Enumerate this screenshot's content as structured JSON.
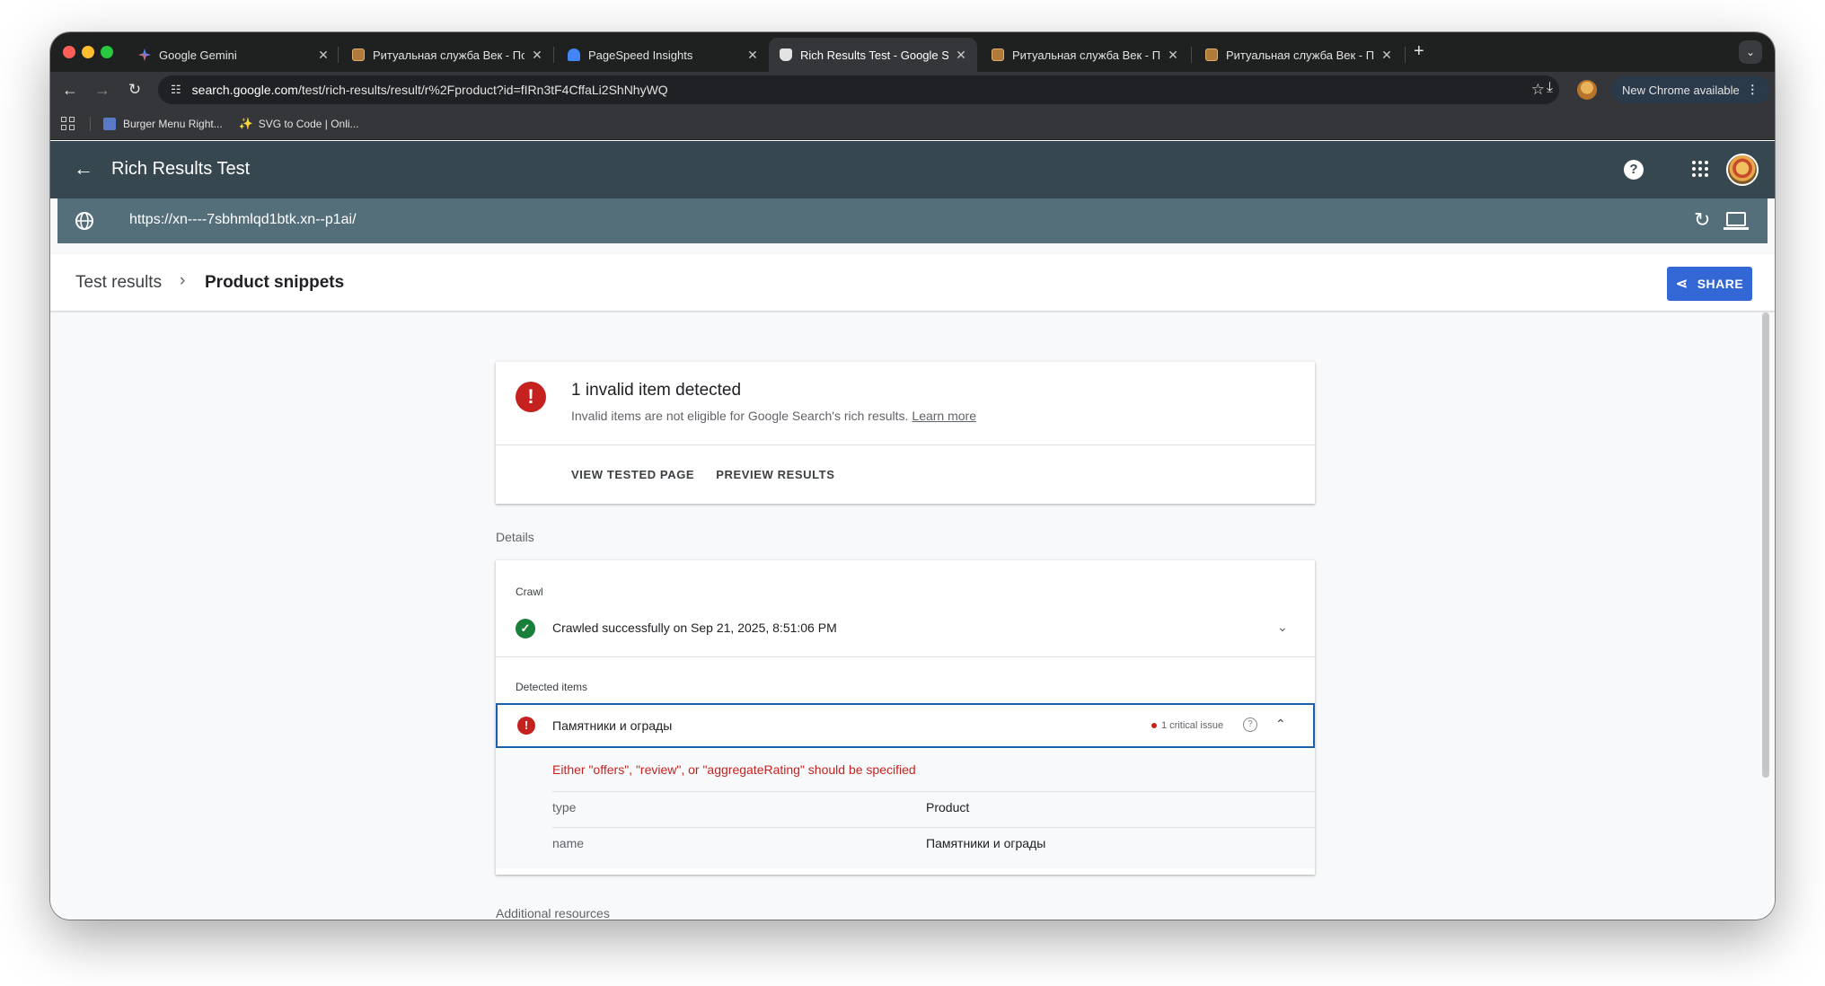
{
  "browser": {
    "tabs": [
      {
        "title": "Google Gemini",
        "active": false
      },
      {
        "title": "Ритуальная служба Век - По",
        "active": false
      },
      {
        "title": "PageSpeed Insights",
        "active": false
      },
      {
        "title": "Rich Results Test - Google Se",
        "active": true
      },
      {
        "title": "Ритуальная служба Век - По",
        "active": false
      },
      {
        "title": "Ритуальная служба Век - По",
        "active": false
      }
    ],
    "address_domain": "search.google.com",
    "address_path": "/test/rich-results/result/r%2Fproduct?id=fIRn3tF4CffaLi2ShNhyWQ",
    "update_label": "New Chrome available",
    "bookmarks": [
      {
        "label": "Burger Menu Right..."
      },
      {
        "label": "SVG to Code | Onli..."
      }
    ]
  },
  "app": {
    "title": "Rich Results Test",
    "tested_url": "https://xn----7sbhmlqd1btk.xn--p1ai/"
  },
  "breadcrumb": {
    "parent": "Test results",
    "current": "Product snippets",
    "share_label": "SHARE"
  },
  "summary": {
    "heading": "1 invalid item detected",
    "subtext": "Invalid items are not eligible for Google Search's rich results.",
    "learn_more": "Learn more",
    "actions": [
      "VIEW TESTED PAGE",
      "PREVIEW RESULTS"
    ]
  },
  "details": {
    "label": "Details",
    "crawl_label": "Crawl",
    "crawl_status": "Crawled successfully on Sep 21, 2025, 8:51:06 PM",
    "detected_label": "Detected items",
    "item": {
      "name": "Памятники и ограды",
      "issue": "1 critical issue",
      "error": "Either \"offers\", \"review\", or \"aggregateRating\" should be specified",
      "properties": [
        {
          "key": "type",
          "value": "Product"
        },
        {
          "key": "name",
          "value": "Памятники и ограды"
        }
      ]
    }
  },
  "additional_label": "Additional resources",
  "colors": {
    "header": "#37474f",
    "urlbar": "#546e7a",
    "share": "#3367d6",
    "error": "#c5221f",
    "success": "#188038"
  }
}
